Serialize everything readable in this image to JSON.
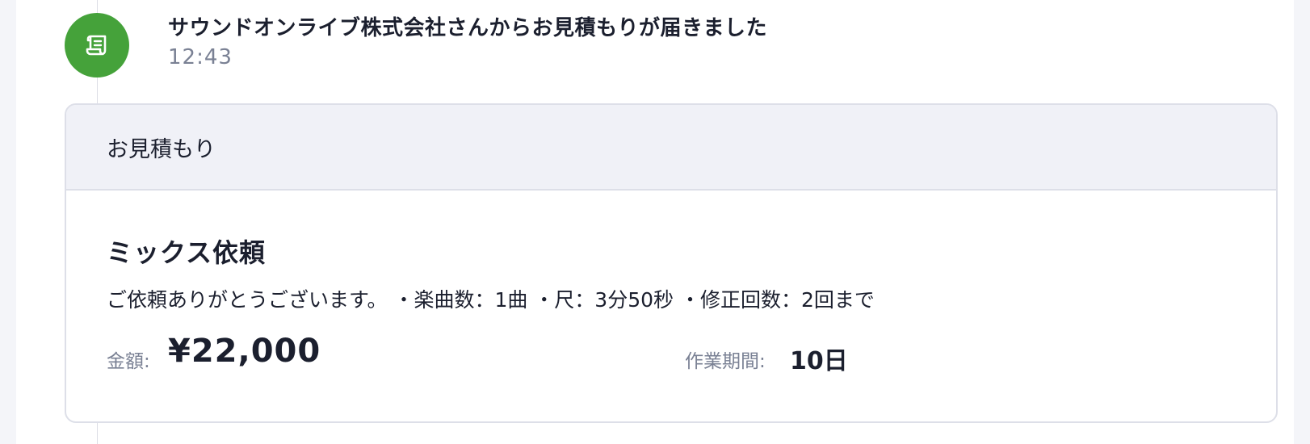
{
  "event": {
    "icon": "scroll-icon",
    "icon_color": "#45a23a",
    "title": "サウンドオンライブ株式会社さんからお見積もりが届きました",
    "time": "12:43"
  },
  "quote_card": {
    "header_title": "お見積もり",
    "item_title": "ミックス依頼",
    "description": "ご依頼ありがとうございます。 ・楽曲数：1曲 ・尺：3分50秒 ・修正回数：2回まで",
    "price_label": "金額:",
    "price_value": "¥22,000",
    "period_label": "作業期間:",
    "period_value": "10日"
  }
}
